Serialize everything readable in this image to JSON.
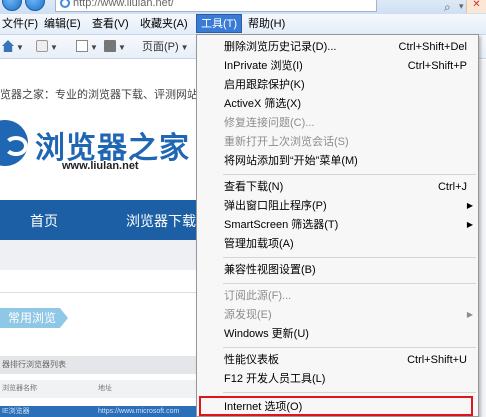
{
  "address_bar": {
    "url": "http://www.liulan.net/"
  },
  "menubar": {
    "items": [
      {
        "label": "文件(F)"
      },
      {
        "label": "编辑(E)"
      },
      {
        "label": "查看(V)"
      },
      {
        "label": "收藏夹(A)"
      },
      {
        "label": "工具(T)"
      },
      {
        "label": "帮助(H)"
      }
    ]
  },
  "toolbar": {
    "page_label": "页面(P)"
  },
  "website": {
    "tagline": "览器之家：专业的浏览器下载、评测网站",
    "logo_text": "浏览器之家",
    "logo_url": "www.liulan.net",
    "nav": [
      "首页",
      "浏览器下载"
    ],
    "tag": "常用浏览",
    "list_header": "器排行浏览器列表",
    "col_name": "浏览器名称",
    "col_url": "地址",
    "row_name": "IE浏览器",
    "row_url": "https://www.microsoft.com"
  },
  "tools_menu": {
    "items": [
      {
        "label": "删除浏览历史记录(D)...",
        "shortcut": "Ctrl+Shift+Del"
      },
      {
        "label": "InPrivate 浏览(I)",
        "shortcut": "Ctrl+Shift+P"
      },
      {
        "label": "启用跟踪保护(K)"
      },
      {
        "label": "ActiveX 筛选(X)"
      },
      {
        "label": "修复连接问题(C)...",
        "disabled": true
      },
      {
        "label": "重新打开上次浏览会话(S)",
        "disabled": true
      },
      {
        "label": "将网站添加到“开始”菜单(M)"
      },
      {
        "label": "查看下载(N)",
        "shortcut": "Ctrl+J"
      },
      {
        "label": "弹出窗口阻止程序(P)",
        "submenu": true
      },
      {
        "label": "SmartScreen 筛选器(T)",
        "submenu": true
      },
      {
        "label": "管理加载项(A)"
      },
      {
        "label": "兼容性视图设置(B)"
      },
      {
        "label": "订阅此源(F)...",
        "disabled": true
      },
      {
        "label": "源发现(E)",
        "disabled": true,
        "submenu": true
      },
      {
        "label": "Windows 更新(U)"
      },
      {
        "label": "性能仪表板",
        "shortcut": "Ctrl+Shift+U"
      },
      {
        "label": "F12 开发人员工具(L)"
      },
      {
        "label": "Internet 选项(O)",
        "highlighted": true
      }
    ]
  },
  "colors": {
    "highlight_border": "#e0141b",
    "menu_active": "#3a7bd5",
    "site_blue": "#1d5fa5"
  }
}
